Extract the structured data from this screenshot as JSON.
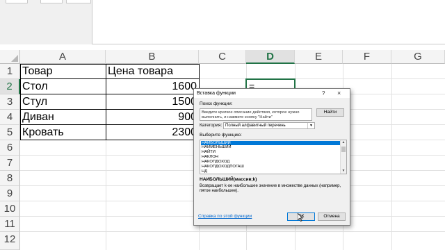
{
  "spreadsheet": {
    "columns": [
      "A",
      "B",
      "C",
      "D",
      "E",
      "F",
      "G"
    ],
    "active_column": "D",
    "rows": [
      "1",
      "2",
      "3",
      "4",
      "5",
      "6",
      "7",
      "8",
      "9",
      "10",
      "11",
      "12"
    ],
    "active_row": "2",
    "header_product": "Товар",
    "header_price": "Цена товара",
    "items": [
      {
        "name": "Стол",
        "price": "1600"
      },
      {
        "name": "Стул",
        "price": "1500"
      },
      {
        "name": "Диван",
        "price": "900"
      },
      {
        "name": "Кровать",
        "price": "2300"
      }
    ],
    "active_cell_value": "="
  },
  "dialog": {
    "title": "Вставка функции",
    "help": "?",
    "close": "×",
    "search_label": "Поиск функции:",
    "search_text": "Введите краткое описание действия, которое нужно выполнить, и нажмите кнопку \"Найти\"",
    "find_button": "Найти",
    "category_label": "Категория:",
    "category_value": "Полный алфавитный перечень",
    "select_label": "Выберите функцию:",
    "functions": [
      "НАИБОЛЬШИЙ",
      "НАИМЕНЬШИЙ",
      "НАЙТИ",
      "НАКЛОН",
      "НАКОПДОХОД",
      "НАКОПДОХОДПОГАШ",
      "НД"
    ],
    "selected_function": "НАИБОЛЬШИЙ",
    "signature": "НАИБОЛЬШИЙ(массив;k)",
    "description": "Возвращает k-ое наибольшее значение в множестве данных (например, пятое наибольшее).",
    "help_link": "Справка по этой функции",
    "ok_button": "ОК",
    "cancel_button": "Отмена"
  }
}
